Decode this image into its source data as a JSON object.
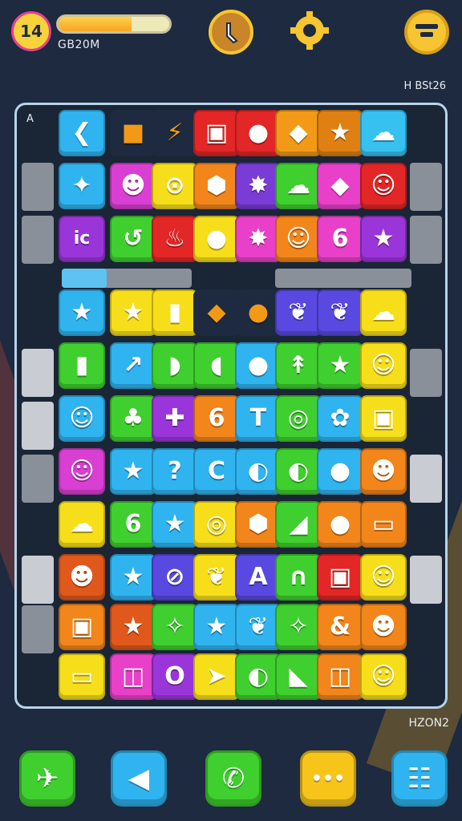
{
  "hud": {
    "level": "14",
    "progress": 0.66,
    "label": "GB20M",
    "score_label": "H BSt26",
    "corner_label": "A",
    "footer_label": "HZON2"
  },
  "colors": {
    "background": "#1d2a3f",
    "board_border": "#b9d3ea",
    "gold": "#f6c531"
  },
  "board": {
    "rows": 11,
    "cols": 7,
    "tiles": [
      [
        {
          "c": "#2fb4f0",
          "i": "❮"
        },
        {
          "c": "#1d2a3f",
          "i": "■"
        },
        {
          "c": "#1d2a3f",
          "i": "⚡"
        },
        {
          "c": "#e32626",
          "i": "▣"
        },
        {
          "c": "#e32626",
          "i": "●"
        },
        {
          "c": "#f29a17",
          "i": "◆"
        },
        {
          "c": "#e07f12",
          "i": "★"
        },
        {
          "c": "#37c1f0",
          "i": "☁"
        }
      ],
      [
        {
          "c": "#2fb4f0",
          "i": "✦"
        },
        {
          "c": "#d93fd2",
          "i": "☻"
        },
        {
          "c": "#f7de1a",
          "i": "⊙"
        },
        {
          "c": "#f2861b",
          "i": "⬢"
        },
        {
          "c": "#7a3bd6",
          "i": "✸"
        },
        {
          "c": "#3fcf2e",
          "i": "☁"
        },
        {
          "c": "#e840c8",
          "i": "◆"
        },
        {
          "c": "#e32626",
          "i": "☺"
        }
      ],
      [
        {
          "c": "#9a36d9",
          "i": "ic"
        },
        {
          "c": "#3fcf2e",
          "i": "↺"
        },
        {
          "c": "#e32626",
          "i": "♨"
        },
        {
          "c": "#f7de1a",
          "i": "●"
        },
        {
          "c": "#e840c8",
          "i": "✸"
        },
        {
          "c": "#f2861b",
          "i": "☺"
        },
        {
          "c": "#e840c8",
          "i": "6"
        },
        {
          "c": "#9a36d9",
          "i": "★"
        }
      ],
      [
        {
          "c": "#2fb4f0",
          "i": "★"
        },
        {
          "c": "#f7de1a",
          "i": "★"
        },
        {
          "c": "#f7de1a",
          "i": "▮"
        },
        {
          "c": "#1d2a3f",
          "i": "◆"
        },
        {
          "c": "#1d2a3f",
          "i": "●"
        },
        {
          "c": "#5a49e0",
          "i": "❦"
        },
        {
          "c": "#5a49e0",
          "i": "❦"
        },
        {
          "c": "#f7de1a",
          "i": "☁"
        }
      ],
      [
        {
          "c": "#3fcf2e",
          "i": "▮"
        },
        {
          "c": "#2fb4f0",
          "i": "↗"
        },
        {
          "c": "#3fcf2e",
          "i": "◗"
        },
        {
          "c": "#3fcf2e",
          "i": "◖"
        },
        {
          "c": "#2fb4f0",
          "i": "●"
        },
        {
          "c": "#3fcf2e",
          "i": "↟"
        },
        {
          "c": "#3fcf2e",
          "i": "★"
        },
        {
          "c": "#f7de1a",
          "i": "☺"
        }
      ],
      [
        {
          "c": "#2fb4f0",
          "i": "☺"
        },
        {
          "c": "#3fcf2e",
          "i": "♣"
        },
        {
          "c": "#9a36d9",
          "i": "✚"
        },
        {
          "c": "#f2861b",
          "i": "6"
        },
        {
          "c": "#2fb4f0",
          "i": "T"
        },
        {
          "c": "#3fcf2e",
          "i": "◎"
        },
        {
          "c": "#2fb4f0",
          "i": "✿"
        },
        {
          "c": "#f7de1a",
          "i": "▣"
        }
      ],
      [
        {
          "c": "#d93fd2",
          "i": "☺"
        },
        {
          "c": "#2fb4f0",
          "i": "★"
        },
        {
          "c": "#2fb4f0",
          "i": "?"
        },
        {
          "c": "#2fb4f0",
          "i": "C"
        },
        {
          "c": "#2fb4f0",
          "i": "◐"
        },
        {
          "c": "#3fcf2e",
          "i": "◐"
        },
        {
          "c": "#2fb4f0",
          "i": "●"
        },
        {
          "c": "#f2861b",
          "i": "☻"
        }
      ],
      [
        {
          "c": "#f7de1a",
          "i": "☁"
        },
        {
          "c": "#3fcf2e",
          "i": "6"
        },
        {
          "c": "#2fb4f0",
          "i": "★"
        },
        {
          "c": "#f7de1a",
          "i": "◎"
        },
        {
          "c": "#f2861b",
          "i": "⬢"
        },
        {
          "c": "#3fcf2e",
          "i": "◢"
        },
        {
          "c": "#f2861b",
          "i": "●"
        },
        {
          "c": "#f2861b",
          "i": "▭"
        }
      ],
      [
        {
          "c": "#e0581b",
          "i": "☻"
        },
        {
          "c": "#2fb4f0",
          "i": "★"
        },
        {
          "c": "#5a49e0",
          "i": "⊘"
        },
        {
          "c": "#f7de1a",
          "i": "❦"
        },
        {
          "c": "#5a49e0",
          "i": "A"
        },
        {
          "c": "#3fcf2e",
          "i": "∩"
        },
        {
          "c": "#e32626",
          "i": "▣"
        },
        {
          "c": "#f7de1a",
          "i": "☺"
        }
      ],
      [
        {
          "c": "#f2861b",
          "i": "▣"
        },
        {
          "c": "#e0581b",
          "i": "★"
        },
        {
          "c": "#3fcf2e",
          "i": "✧"
        },
        {
          "c": "#2fb4f0",
          "i": "★"
        },
        {
          "c": "#2fb4f0",
          "i": "❦"
        },
        {
          "c": "#3fcf2e",
          "i": "✧"
        },
        {
          "c": "#f2861b",
          "i": "&"
        },
        {
          "c": "#f2861b",
          "i": "☻"
        }
      ],
      [
        {
          "c": "#f7de1a",
          "i": "▭"
        },
        {
          "c": "#e840c8",
          "i": "◫"
        },
        {
          "c": "#9a36d9",
          "i": "O"
        },
        {
          "c": "#f7de1a",
          "i": "➤"
        },
        {
          "c": "#3fcf2e",
          "i": "◐"
        },
        {
          "c": "#3fcf2e",
          "i": "◣"
        },
        {
          "c": "#f2861b",
          "i": "◫"
        },
        {
          "c": "#f7de1a",
          "i": "☺"
        }
      ]
    ]
  },
  "nav": [
    {
      "name": "fish-button",
      "color": "#3fcf2e",
      "icon": "✈"
    },
    {
      "name": "back-button",
      "color": "#2fb4f0",
      "icon": "◀"
    },
    {
      "name": "phone-button",
      "color": "#3fcf2e",
      "icon": "✆"
    },
    {
      "name": "more-button",
      "color": "#f7c51a",
      "icon": "•••"
    },
    {
      "name": "menu-button",
      "color": "#2fb4f0",
      "icon": "☷"
    }
  ]
}
